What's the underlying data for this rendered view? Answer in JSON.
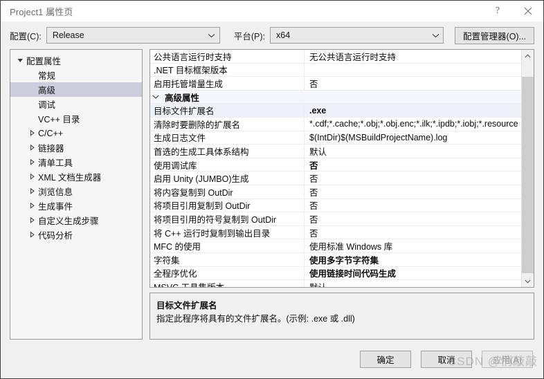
{
  "window": {
    "title": "Project1 属性页",
    "help_icon": "question-mark-icon",
    "close_icon": "close-x-icon"
  },
  "config_bar": {
    "config_label": "配置(C):",
    "config_value": "Release",
    "platform_label": "平台(P):",
    "platform_value": "x64",
    "config_manager_button": "配置管理器(O)...",
    "dropdown_icon": "chevron-down-icon"
  },
  "tree": {
    "items": [
      {
        "label": "配置属性",
        "depth": 0,
        "twisty": "expanded",
        "selected": false
      },
      {
        "label": "常规",
        "depth": 1,
        "twisty": "none",
        "selected": false
      },
      {
        "label": "高级",
        "depth": 1,
        "twisty": "none",
        "selected": true
      },
      {
        "label": "调试",
        "depth": 1,
        "twisty": "none",
        "selected": false
      },
      {
        "label": "VC++ 目录",
        "depth": 1,
        "twisty": "none",
        "selected": false
      },
      {
        "label": "C/C++",
        "depth": 1,
        "twisty": "collapsed",
        "selected": false
      },
      {
        "label": "链接器",
        "depth": 1,
        "twisty": "collapsed",
        "selected": false
      },
      {
        "label": "清单工具",
        "depth": 1,
        "twisty": "collapsed",
        "selected": false
      },
      {
        "label": "XML 文档生成器",
        "depth": 1,
        "twisty": "collapsed",
        "selected": false
      },
      {
        "label": "浏览信息",
        "depth": 1,
        "twisty": "collapsed",
        "selected": false
      },
      {
        "label": "生成事件",
        "depth": 1,
        "twisty": "collapsed",
        "selected": false
      },
      {
        "label": "自定义生成步骤",
        "depth": 1,
        "twisty": "collapsed",
        "selected": false
      },
      {
        "label": "代码分析",
        "depth": 1,
        "twisty": "collapsed",
        "selected": false
      }
    ]
  },
  "property_grid": {
    "rows": [
      {
        "name": "公共语言运行时支持",
        "value": "无公共语言运行时支持",
        "group": false,
        "bold": false,
        "selected": false
      },
      {
        "name": ".NET 目标框架版本",
        "value": "",
        "group": false,
        "bold": false,
        "selected": false
      },
      {
        "name": "启用托管增量生成",
        "value": "否",
        "group": false,
        "bold": false,
        "selected": false
      },
      {
        "name": "高级属性",
        "value": "",
        "group": true,
        "bold": false,
        "selected": false,
        "twisty": "expanded"
      },
      {
        "name": "目标文件扩展名",
        "value": ".exe",
        "group": false,
        "bold": true,
        "selected": true
      },
      {
        "name": "清除时要删除的扩展名",
        "value": "*.cdf;*.cache;*.obj;*.obj.enc;*.ilk;*.ipdb;*.iobj;*.resource",
        "group": false,
        "bold": false,
        "selected": false
      },
      {
        "name": "生成日志文件",
        "value": "$(IntDir)$(MSBuildProjectName).log",
        "group": false,
        "bold": false,
        "selected": false
      },
      {
        "name": "首选的生成工具体系结构",
        "value": "默认",
        "group": false,
        "bold": false,
        "selected": false
      },
      {
        "name": "使用调试库",
        "value": "否",
        "group": false,
        "bold": true,
        "selected": false
      },
      {
        "name": "启用 Unity (JUMBO)生成",
        "value": "否",
        "group": false,
        "bold": false,
        "selected": false
      },
      {
        "name": "将内容复制到 OutDir",
        "value": "否",
        "group": false,
        "bold": false,
        "selected": false
      },
      {
        "name": "将项目引用复制到 OutDir",
        "value": "否",
        "group": false,
        "bold": false,
        "selected": false
      },
      {
        "name": "将项目引用的符号复制到 OutDir",
        "value": "否",
        "group": false,
        "bold": false,
        "selected": false
      },
      {
        "name": "将 C++ 运行时复制到输出目录",
        "value": "否",
        "group": false,
        "bold": false,
        "selected": false
      },
      {
        "name": "MFC 的使用",
        "value": "使用标准 Windows 库",
        "group": false,
        "bold": false,
        "selected": false
      },
      {
        "name": "字符集",
        "value": "使用多字节字符集",
        "group": false,
        "bold": true,
        "selected": false
      },
      {
        "name": "全程序优化",
        "value": "使用链接时间代码生成",
        "group": false,
        "bold": true,
        "selected": false
      },
      {
        "name": "MSVC 工具集版本",
        "value": "默认",
        "group": false,
        "bold": false,
        "selected": false
      }
    ],
    "scrollbar": {
      "up_icon": "chevron-up-icon",
      "down_icon": "chevron-down-icon"
    }
  },
  "description": {
    "title": "目标文件扩展名",
    "body": "指定此程序将具有的文件扩展名。(示例: .exe 或 .dll)"
  },
  "footer": {
    "ok_label": "确定",
    "cancel_label": "取消",
    "apply_label": "应用(A)"
  },
  "watermark": {
    "text": "CSDN @悄敲敲"
  }
}
